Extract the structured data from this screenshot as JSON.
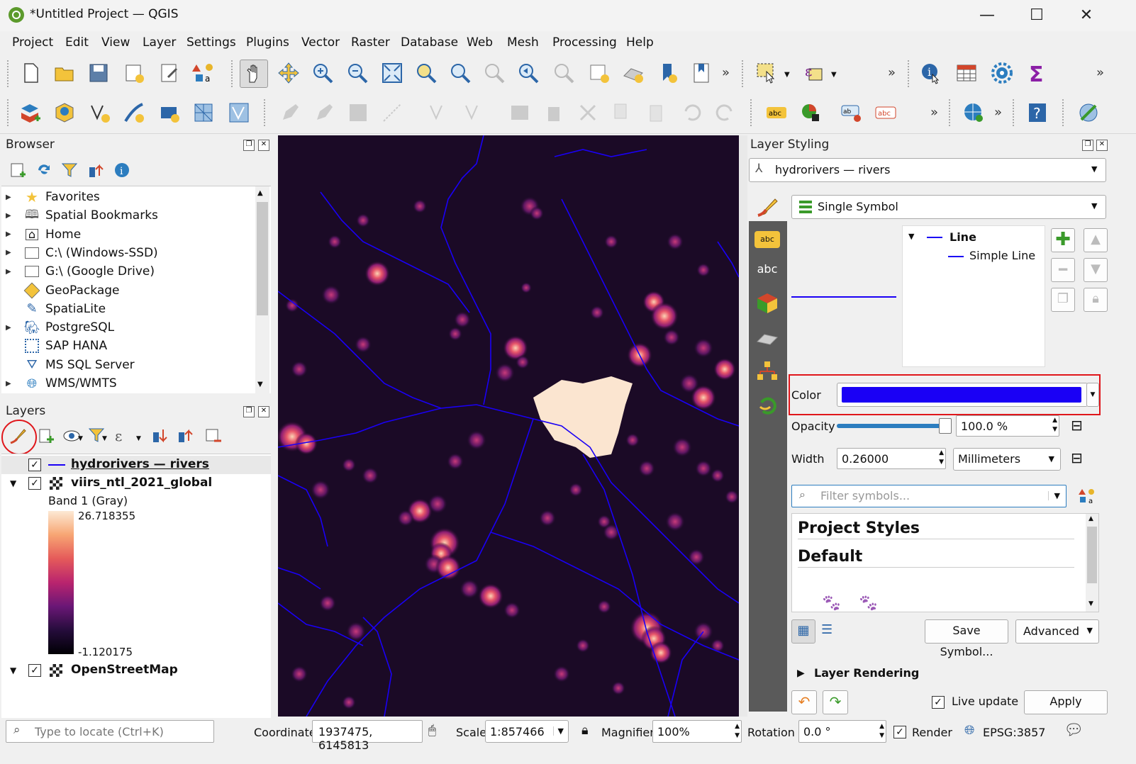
{
  "window": {
    "title": "*Untitled Project — QGIS"
  },
  "menubar": [
    "Project",
    "Edit",
    "View",
    "Layer",
    "Settings",
    "Plugins",
    "Vector",
    "Raster",
    "Database",
    "Web",
    "Mesh",
    "Processing",
    "Help"
  ],
  "browser": {
    "title": "Browser",
    "items": [
      {
        "label": "Favorites",
        "icon": "star-icon",
        "expand": true
      },
      {
        "label": "Spatial Bookmarks",
        "icon": "bookmark-icon",
        "expand": true
      },
      {
        "label": "Home",
        "icon": "home-folder-icon",
        "expand": true
      },
      {
        "label": "C:\\ (Windows-SSD)",
        "icon": "folder-icon",
        "expand": true
      },
      {
        "label": "G:\\ (Google Drive)",
        "icon": "folder-icon",
        "expand": true
      },
      {
        "label": "GeoPackage",
        "icon": "geopackage-icon",
        "expand": false
      },
      {
        "label": "SpatiaLite",
        "icon": "spatialite-icon",
        "expand": false
      },
      {
        "label": "PostgreSQL",
        "icon": "postgresql-icon",
        "expand": true
      },
      {
        "label": "SAP HANA",
        "icon": "sap-hana-icon",
        "expand": false
      },
      {
        "label": "MS SQL Server",
        "icon": "mssql-icon",
        "expand": false
      },
      {
        "label": "WMS/WMTS",
        "icon": "wms-icon",
        "expand": true
      }
    ]
  },
  "layers": {
    "title": "Layers",
    "items": [
      {
        "label": "hydrorivers — rivers",
        "checked": true
      },
      {
        "label": "viirs_ntl_2021_global",
        "checked": true
      },
      {
        "label": "OpenStreetMap",
        "checked": true
      }
    ],
    "band_label": "Band 1 (Gray)",
    "ramp_max": "26.718355",
    "ramp_min": "-1.120175"
  },
  "styling": {
    "title": "Layer Styling",
    "layer_select": "hydrorivers — rivers",
    "renderer": "Single Symbol",
    "symbol_tree": {
      "root": "Line",
      "child": "Simple Line"
    },
    "color_label": "Color",
    "color_value": "#1a00f5",
    "opacity_label": "Opacity",
    "opacity_value": "100.0 %",
    "opacity_fraction": 1.0,
    "width_label": "Width",
    "width_value": "0.26000",
    "unit": "Millimeters",
    "filter_placeholder": "Filter symbols...",
    "style_groups": [
      "Project Styles",
      "Default"
    ],
    "save_symbol": "Save Symbol...",
    "advanced": "Advanced",
    "layer_rendering": "Layer Rendering",
    "live_update": "Live update",
    "apply": "Apply"
  },
  "status": {
    "locate_placeholder": "Type to locate (Ctrl+K)",
    "coordinate_label": "Coordinate",
    "coordinate_value": "1937475, 6145813",
    "scale_label": "Scale",
    "scale_value": "1:857466",
    "magnifier_label": "Magnifier",
    "magnifier_value": "100%",
    "rotation_label": "Rotation",
    "rotation_value": "0.0 °",
    "render_label": "Render",
    "crs": "EPSG:3857"
  },
  "colors": {
    "accent_red": "#e0161b",
    "river_blue": "#1a00f5",
    "map_bg": "#1b0a26"
  }
}
